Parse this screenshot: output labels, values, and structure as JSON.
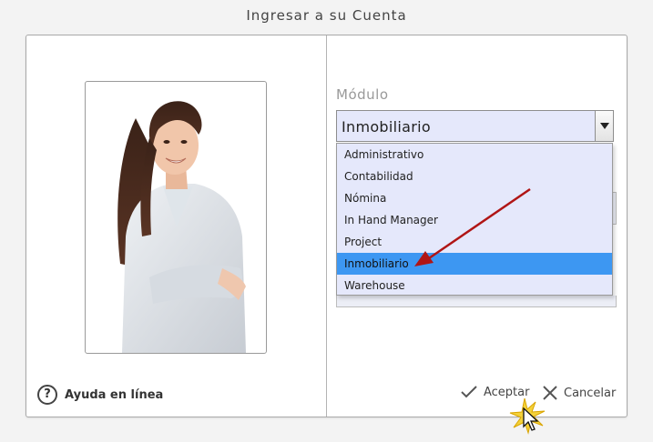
{
  "window": {
    "title": "Ingresar a su Cuenta"
  },
  "help": {
    "label": "Ayuda en línea",
    "icon": "question-circle-icon"
  },
  "module": {
    "label": "Módulo",
    "selected_value": "Inmobiliario",
    "options": [
      "Administrativo",
      "Contabilidad",
      "Nómina",
      "In Hand Manager",
      "Project",
      "Inmobiliario",
      "Warehouse"
    ],
    "highlighted_index": 5
  },
  "buttons": {
    "accept_label": "Aceptar",
    "cancel_label": "Cancelar"
  },
  "colors": {
    "highlight": "#3d97f2",
    "field_bg": "#e5e8fb",
    "annotation_arrow": "#b01515"
  }
}
